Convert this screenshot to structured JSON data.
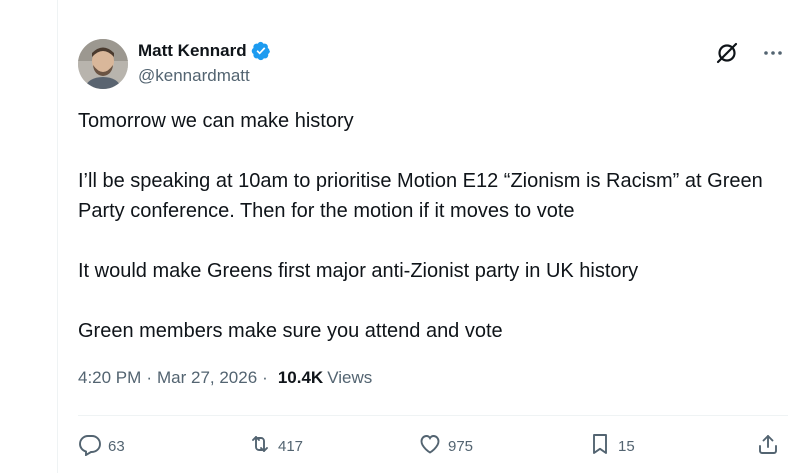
{
  "author": {
    "display_name": "Matt Kennard",
    "handle": "@kennardmatt",
    "verified": true
  },
  "tweet": {
    "paragraphs": [
      "Tomorrow we can make history",
      "I’ll be speaking at 10am to prioritise Motion E12 “Zionism is Racism” at Green Party conference. Then for the motion if it moves to vote",
      "It would make Greens first major anti-Zionist party in UK history",
      "Green members make sure you attend and vote"
    ]
  },
  "meta": {
    "time": "4:20 PM",
    "separator": "·",
    "date": "Mar 27, 2026",
    "views_count": "10.4K",
    "views_label": "Views"
  },
  "actions": {
    "replies": "63",
    "reposts": "417",
    "likes": "975",
    "bookmarks": "15"
  },
  "icons": {
    "verified": "verified-badge-icon",
    "grok": "grok-icon",
    "more": "more-icon",
    "reply": "reply-icon",
    "repost": "repost-icon",
    "like": "heart-icon",
    "bookmark": "bookmark-icon",
    "share": "share-icon"
  },
  "colors": {
    "text": "#0f1419",
    "secondary": "#536471",
    "verified_blue": "#1d9bf0",
    "border": "#eff3f4"
  }
}
